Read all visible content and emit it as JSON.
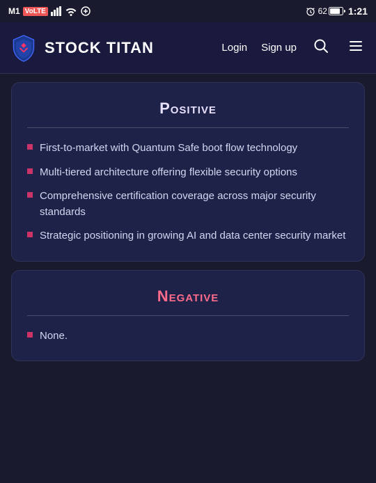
{
  "statusBar": {
    "carrier": "M1",
    "networkType": "VoLTE",
    "time": "1:21",
    "battery": "62"
  },
  "navbar": {
    "logoText": "STOCK TITAN",
    "loginLabel": "Login",
    "signupLabel": "Sign up"
  },
  "positiveCard": {
    "title": "Positive",
    "items": [
      "First-to-market with Quantum Safe boot flow technology",
      "Multi-tiered architecture offering flexible security options",
      "Comprehensive certification coverage across major security standards",
      "Strategic positioning in growing AI and data center security market"
    ]
  },
  "negativeCard": {
    "title": "Negative",
    "items": [
      "None."
    ]
  }
}
